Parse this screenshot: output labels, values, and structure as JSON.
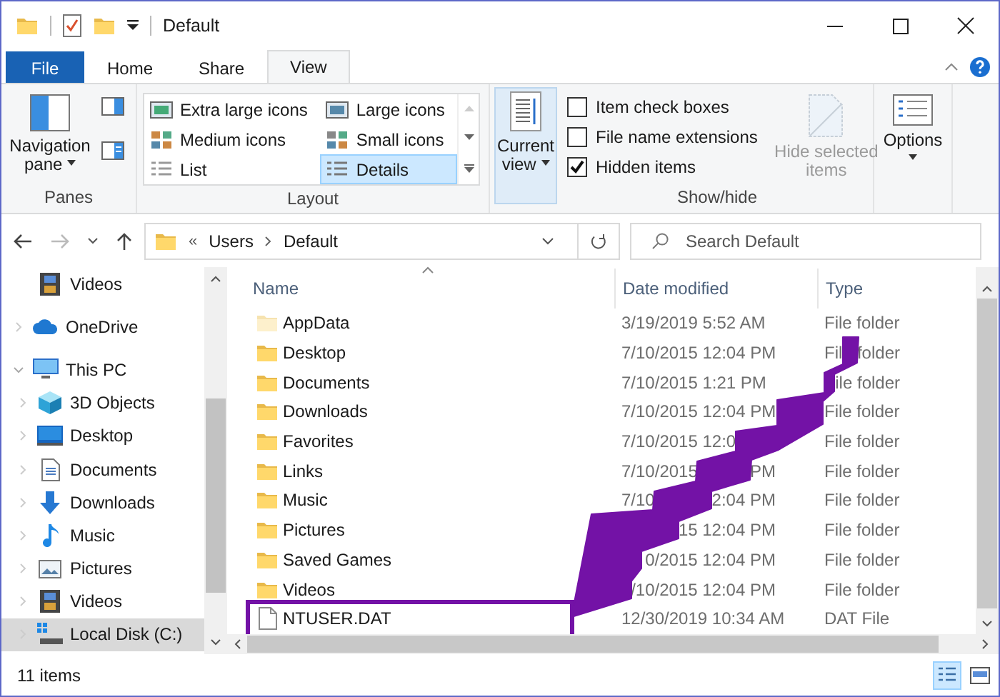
{
  "title_bar": {
    "title": "Default"
  },
  "ribbon": {
    "tabs": [
      {
        "label": "File",
        "kind": "file",
        "selected": false
      },
      {
        "label": "Home",
        "kind": "tab",
        "selected": false
      },
      {
        "label": "Share",
        "kind": "tab",
        "selected": false
      },
      {
        "label": "View",
        "kind": "tab",
        "selected": true
      }
    ],
    "panes": {
      "label": "Panes",
      "navigation_pane": "Navigation pane"
    },
    "layout": {
      "label": "Layout",
      "items": [
        {
          "label": "Extra large icons",
          "kind": "xl",
          "selected": false
        },
        {
          "label": "Large icons",
          "kind": "large",
          "selected": false
        },
        {
          "label": "Medium icons",
          "kind": "medium",
          "selected": false
        },
        {
          "label": "Small icons",
          "kind": "small",
          "selected": false
        },
        {
          "label": "List",
          "kind": "list",
          "selected": false
        },
        {
          "label": "Details",
          "kind": "details",
          "selected": true
        }
      ]
    },
    "current_view": {
      "label": "Current view"
    },
    "show_hide": {
      "label": "Show/hide",
      "checkboxes": [
        {
          "label": "Item check boxes",
          "checked": false
        },
        {
          "label": "File name extensions",
          "checked": false
        },
        {
          "label": "Hidden items",
          "checked": true
        }
      ],
      "hide_selected": {
        "label": "Hide selected items",
        "disabled": true
      }
    },
    "options": {
      "label": "Options"
    }
  },
  "address_bar": {
    "separator": "«",
    "crumbs": [
      "Users",
      "Default"
    ]
  },
  "search": {
    "placeholder": "Search Default"
  },
  "nav": {
    "scrolled_items": [
      {
        "label": "Videos",
        "kind": "videos",
        "selected": false
      }
    ],
    "items": [
      {
        "label": "OneDrive",
        "kind": "onedrive",
        "expanded": false,
        "selected": false
      },
      {
        "label": "This PC",
        "kind": "pc",
        "expanded": true,
        "selected": false,
        "children": [
          {
            "label": "3D Objects",
            "kind": "objects",
            "expanded": false,
            "selected": false
          },
          {
            "label": "Desktop",
            "kind": "desktop",
            "expanded": false,
            "selected": false
          },
          {
            "label": "Documents",
            "kind": "documents",
            "expanded": false,
            "selected": false
          },
          {
            "label": "Downloads",
            "kind": "downloads",
            "expanded": false,
            "selected": false
          },
          {
            "label": "Music",
            "kind": "music",
            "expanded": false,
            "selected": false
          },
          {
            "label": "Pictures",
            "kind": "pictures",
            "expanded": false,
            "selected": false
          },
          {
            "label": "Videos",
            "kind": "videos",
            "expanded": false,
            "selected": false
          },
          {
            "label": "Local Disk (C:)",
            "kind": "disk",
            "expanded": false,
            "selected": true
          }
        ]
      }
    ]
  },
  "columns": [
    "Name",
    "Date modified",
    "Type"
  ],
  "files": [
    {
      "name": "AppData",
      "date": "3/19/2019 5:52 AM",
      "type": "File folder",
      "kind": "folder",
      "hidden": true,
      "highlighted": false
    },
    {
      "name": "Desktop",
      "date": "7/10/2015 12:04 PM",
      "type": "Fil",
      "type_end": "folder",
      "kind": "folder",
      "hidden": false,
      "highlighted": false
    },
    {
      "name": "Documents",
      "date": "7/10/2015 1:21 PM",
      "type_end": "ile folder",
      "kind": "folder",
      "hidden": false,
      "highlighted": false
    },
    {
      "name": "Downloads",
      "date": "7/10/2015 12:04 PM",
      "type": "File folder",
      "kind": "folder",
      "hidden": false,
      "highlighted": false
    },
    {
      "name": "Favorites",
      "date": "7/10/2015 12:0",
      "type": "File folder",
      "kind": "folder",
      "hidden": false,
      "highlighted": false
    },
    {
      "name": "Links",
      "date": "7/10/2015",
      "date_end": "PM",
      "type": "File folder",
      "kind": "folder",
      "hidden": false,
      "highlighted": false
    },
    {
      "name": "Music",
      "date": "7/10",
      "date_end": "2:04 PM",
      "type": "File folder",
      "kind": "folder",
      "hidden": false,
      "highlighted": false
    },
    {
      "name": "Pictures",
      "date_end": "15 12:04 PM",
      "type": "File folder",
      "kind": "folder",
      "hidden": false,
      "highlighted": false
    },
    {
      "name": "Saved Games",
      "date_end": "0/2015 12:04 PM",
      "type": "File folder",
      "kind": "folder",
      "hidden": false,
      "highlighted": false
    },
    {
      "name": "Videos",
      "date_end": "/10/2015 12:04 PM",
      "type": "File folder",
      "kind": "folder",
      "hidden": false,
      "highlighted": false
    },
    {
      "name": "NTUSER.DAT",
      "date": "12/30/2019 10:34 AM",
      "type": "DAT File",
      "kind": "file",
      "hidden": false,
      "highlighted": true
    }
  ],
  "status_bar": {
    "count": "11 items",
    "views": [
      {
        "kind": "details",
        "selected": true
      },
      {
        "kind": "large",
        "selected": false
      }
    ]
  }
}
